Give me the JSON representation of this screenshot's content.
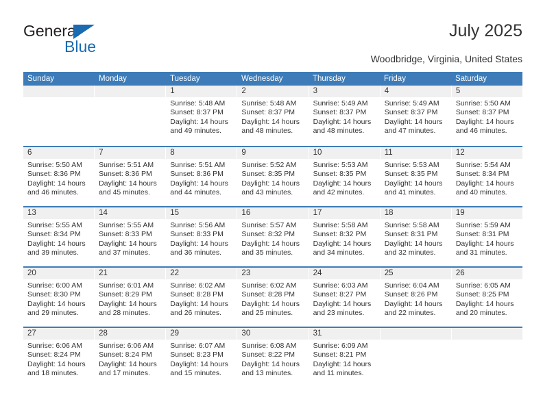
{
  "brand": {
    "name_part1": "General",
    "name_part2": "Blue",
    "triangle_color": "#1a6bb0"
  },
  "header": {
    "title": "July 2025",
    "subtitle": "Woodbridge, Virginia, United States",
    "accent_color": "#3d7cb8"
  },
  "weekdays": [
    "Sunday",
    "Monday",
    "Tuesday",
    "Wednesday",
    "Thursday",
    "Friday",
    "Saturday"
  ],
  "weeks": [
    [
      {
        "day": "",
        "lines": []
      },
      {
        "day": "",
        "lines": []
      },
      {
        "day": "1",
        "lines": [
          "Sunrise: 5:48 AM",
          "Sunset: 8:37 PM",
          "Daylight: 14 hours",
          "and 49 minutes."
        ]
      },
      {
        "day": "2",
        "lines": [
          "Sunrise: 5:48 AM",
          "Sunset: 8:37 PM",
          "Daylight: 14 hours",
          "and 48 minutes."
        ]
      },
      {
        "day": "3",
        "lines": [
          "Sunrise: 5:49 AM",
          "Sunset: 8:37 PM",
          "Daylight: 14 hours",
          "and 48 minutes."
        ]
      },
      {
        "day": "4",
        "lines": [
          "Sunrise: 5:49 AM",
          "Sunset: 8:37 PM",
          "Daylight: 14 hours",
          "and 47 minutes."
        ]
      },
      {
        "day": "5",
        "lines": [
          "Sunrise: 5:50 AM",
          "Sunset: 8:37 PM",
          "Daylight: 14 hours",
          "and 46 minutes."
        ]
      }
    ],
    [
      {
        "day": "6",
        "lines": [
          "Sunrise: 5:50 AM",
          "Sunset: 8:36 PM",
          "Daylight: 14 hours",
          "and 46 minutes."
        ]
      },
      {
        "day": "7",
        "lines": [
          "Sunrise: 5:51 AM",
          "Sunset: 8:36 PM",
          "Daylight: 14 hours",
          "and 45 minutes."
        ]
      },
      {
        "day": "8",
        "lines": [
          "Sunrise: 5:51 AM",
          "Sunset: 8:36 PM",
          "Daylight: 14 hours",
          "and 44 minutes."
        ]
      },
      {
        "day": "9",
        "lines": [
          "Sunrise: 5:52 AM",
          "Sunset: 8:35 PM",
          "Daylight: 14 hours",
          "and 43 minutes."
        ]
      },
      {
        "day": "10",
        "lines": [
          "Sunrise: 5:53 AM",
          "Sunset: 8:35 PM",
          "Daylight: 14 hours",
          "and 42 minutes."
        ]
      },
      {
        "day": "11",
        "lines": [
          "Sunrise: 5:53 AM",
          "Sunset: 8:35 PM",
          "Daylight: 14 hours",
          "and 41 minutes."
        ]
      },
      {
        "day": "12",
        "lines": [
          "Sunrise: 5:54 AM",
          "Sunset: 8:34 PM",
          "Daylight: 14 hours",
          "and 40 minutes."
        ]
      }
    ],
    [
      {
        "day": "13",
        "lines": [
          "Sunrise: 5:55 AM",
          "Sunset: 8:34 PM",
          "Daylight: 14 hours",
          "and 39 minutes."
        ]
      },
      {
        "day": "14",
        "lines": [
          "Sunrise: 5:55 AM",
          "Sunset: 8:33 PM",
          "Daylight: 14 hours",
          "and 37 minutes."
        ]
      },
      {
        "day": "15",
        "lines": [
          "Sunrise: 5:56 AM",
          "Sunset: 8:33 PM",
          "Daylight: 14 hours",
          "and 36 minutes."
        ]
      },
      {
        "day": "16",
        "lines": [
          "Sunrise: 5:57 AM",
          "Sunset: 8:32 PM",
          "Daylight: 14 hours",
          "and 35 minutes."
        ]
      },
      {
        "day": "17",
        "lines": [
          "Sunrise: 5:58 AM",
          "Sunset: 8:32 PM",
          "Daylight: 14 hours",
          "and 34 minutes."
        ]
      },
      {
        "day": "18",
        "lines": [
          "Sunrise: 5:58 AM",
          "Sunset: 8:31 PM",
          "Daylight: 14 hours",
          "and 32 minutes."
        ]
      },
      {
        "day": "19",
        "lines": [
          "Sunrise: 5:59 AM",
          "Sunset: 8:31 PM",
          "Daylight: 14 hours",
          "and 31 minutes."
        ]
      }
    ],
    [
      {
        "day": "20",
        "lines": [
          "Sunrise: 6:00 AM",
          "Sunset: 8:30 PM",
          "Daylight: 14 hours",
          "and 29 minutes."
        ]
      },
      {
        "day": "21",
        "lines": [
          "Sunrise: 6:01 AM",
          "Sunset: 8:29 PM",
          "Daylight: 14 hours",
          "and 28 minutes."
        ]
      },
      {
        "day": "22",
        "lines": [
          "Sunrise: 6:02 AM",
          "Sunset: 8:28 PM",
          "Daylight: 14 hours",
          "and 26 minutes."
        ]
      },
      {
        "day": "23",
        "lines": [
          "Sunrise: 6:02 AM",
          "Sunset: 8:28 PM",
          "Daylight: 14 hours",
          "and 25 minutes."
        ]
      },
      {
        "day": "24",
        "lines": [
          "Sunrise: 6:03 AM",
          "Sunset: 8:27 PM",
          "Daylight: 14 hours",
          "and 23 minutes."
        ]
      },
      {
        "day": "25",
        "lines": [
          "Sunrise: 6:04 AM",
          "Sunset: 8:26 PM",
          "Daylight: 14 hours",
          "and 22 minutes."
        ]
      },
      {
        "day": "26",
        "lines": [
          "Sunrise: 6:05 AM",
          "Sunset: 8:25 PM",
          "Daylight: 14 hours",
          "and 20 minutes."
        ]
      }
    ],
    [
      {
        "day": "27",
        "lines": [
          "Sunrise: 6:06 AM",
          "Sunset: 8:24 PM",
          "Daylight: 14 hours",
          "and 18 minutes."
        ]
      },
      {
        "day": "28",
        "lines": [
          "Sunrise: 6:06 AM",
          "Sunset: 8:24 PM",
          "Daylight: 14 hours",
          "and 17 minutes."
        ]
      },
      {
        "day": "29",
        "lines": [
          "Sunrise: 6:07 AM",
          "Sunset: 8:23 PM",
          "Daylight: 14 hours",
          "and 15 minutes."
        ]
      },
      {
        "day": "30",
        "lines": [
          "Sunrise: 6:08 AM",
          "Sunset: 8:22 PM",
          "Daylight: 14 hours",
          "and 13 minutes."
        ]
      },
      {
        "day": "31",
        "lines": [
          "Sunrise: 6:09 AM",
          "Sunset: 8:21 PM",
          "Daylight: 14 hours",
          "and 11 minutes."
        ]
      },
      {
        "day": "",
        "lines": []
      },
      {
        "day": "",
        "lines": []
      }
    ]
  ]
}
